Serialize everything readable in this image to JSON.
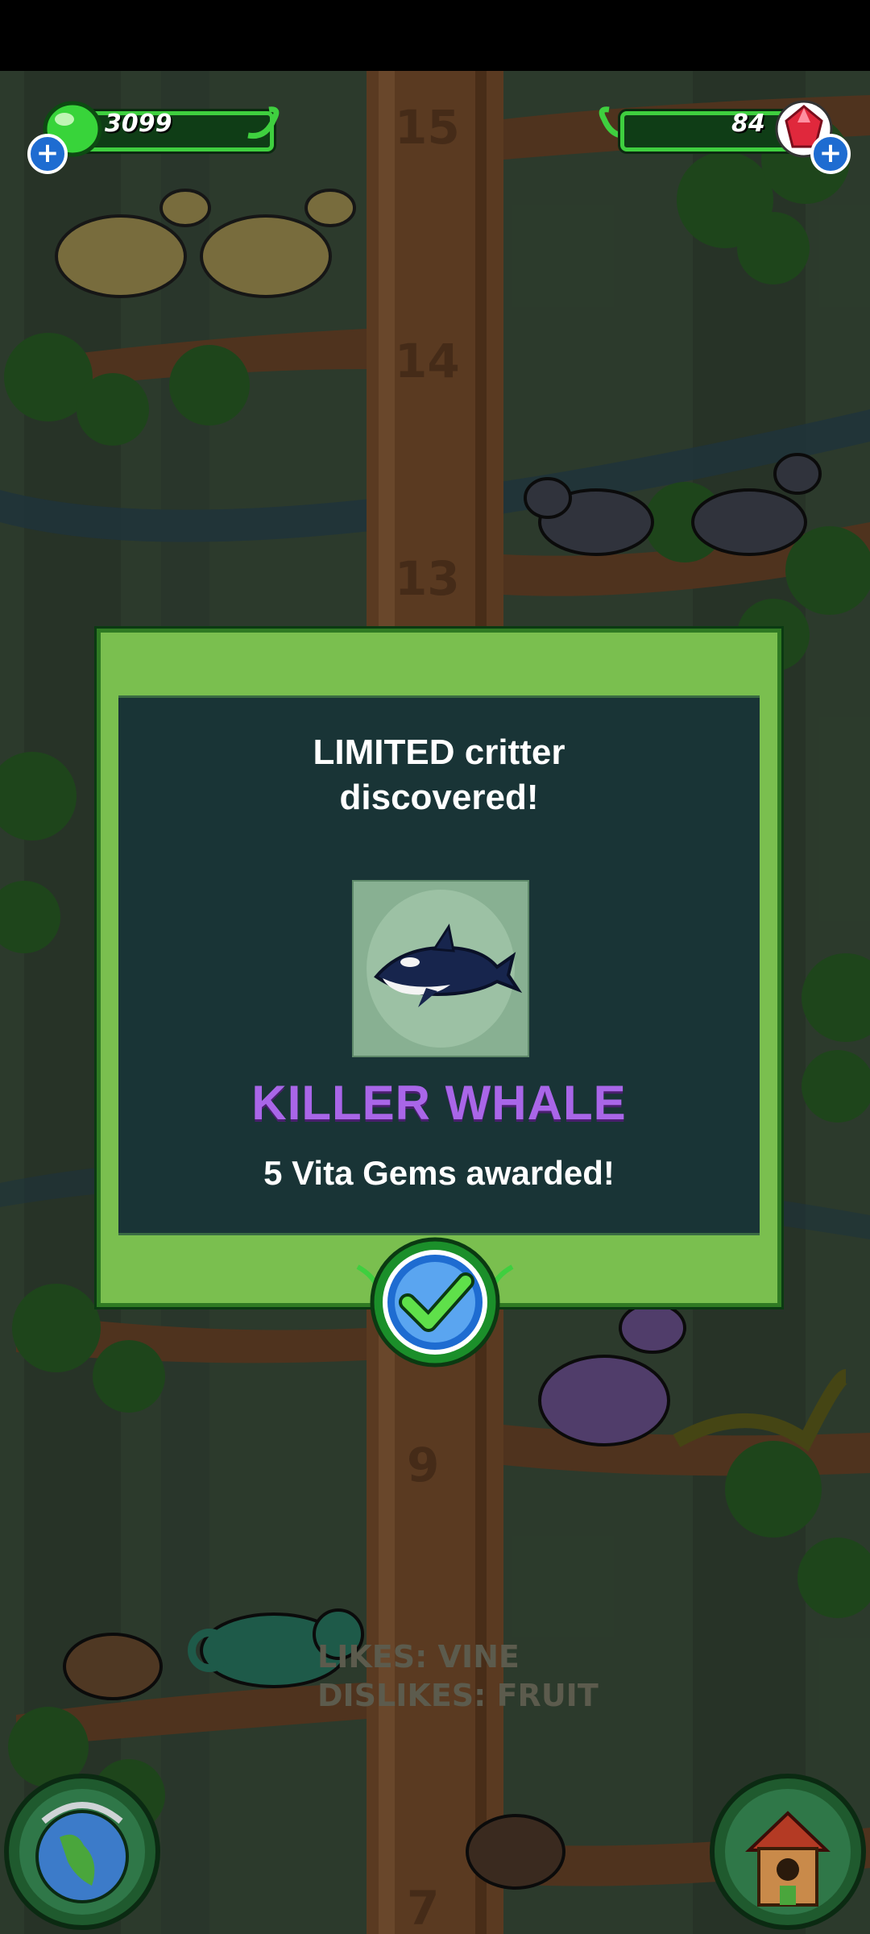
{
  "hud": {
    "green_gems": "3099",
    "vita_gems": "84",
    "plus_symbol": "+"
  },
  "tree_levels": [
    "15",
    "14",
    "13",
    "9",
    "7"
  ],
  "dialog": {
    "title_line1": "LIMITED critter",
    "title_line2": "discovered!",
    "critter_name": "KILLER WHALE",
    "reward_text": "5 Vita Gems awarded!"
  },
  "critter_info": {
    "likes": "LIKES: VINE",
    "dislikes": "DISLIKES: FRUIT"
  },
  "colors": {
    "dialog_frame": "#7abf4f",
    "dialog_inner": "#193436",
    "critter_name": "#a966e8",
    "hud_bar": "#3fcf3f"
  }
}
